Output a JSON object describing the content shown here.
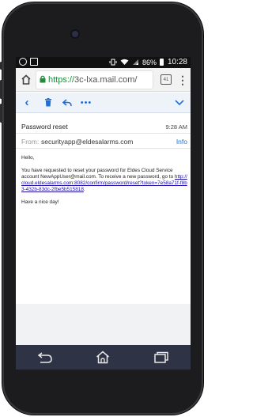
{
  "statusbar": {
    "battery": "86%",
    "time": "10:28"
  },
  "browser": {
    "url_scheme": "https://",
    "url_host": "3c-lxa.mail.com/",
    "tab_count": "41"
  },
  "message": {
    "subject": "Password reset",
    "time": "9:28 AM",
    "from_label": "From:",
    "from_address": "securityapp@eldesalarms.com",
    "info_label": "Info",
    "greeting": "Hello,",
    "paragraph": "You have requested to reset your password for Eldes Cloud Service account NewAppUser@mail.com. To receive a new password, go to",
    "link": "http://cloud.eldesalarms.com:8082/confirm/password/reset?token=7e58a71f-f8b3-432b-83dc-2fbe5b515818",
    "link_suffix": ".",
    "closing": "Have a nice day!"
  },
  "icons": {
    "statusbar": [
      "whatsapp-icon",
      "image-icon",
      "vibrate-icon",
      "wifi-icon",
      "signal-icon",
      "battery-icon"
    ],
    "browser": [
      "home-icon",
      "lock-icon",
      "tabs-icon",
      "menu-icon"
    ],
    "mail": [
      "back-icon",
      "trash-icon",
      "reply-icon",
      "more-icon",
      "chevron-down-icon"
    ],
    "nav": [
      "back-nav-icon",
      "home-nav-icon",
      "recents-nav-icon"
    ]
  },
  "colors": {
    "accent": "#1f6fd6",
    "link": "#1a0dab",
    "navbar": "#2e3345",
    "lock": "#1e8e3e"
  }
}
